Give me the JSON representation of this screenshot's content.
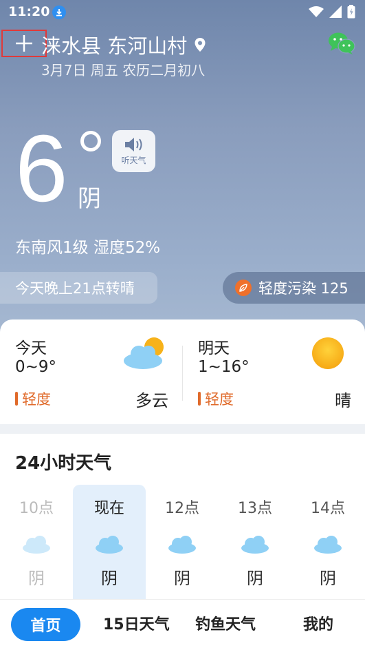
{
  "status_bar": {
    "time": "11:20"
  },
  "header": {
    "location": "涞水县 东河山村",
    "date": "3月7日 周五 农历二月初八"
  },
  "current": {
    "temperature": "6",
    "condition": "阴",
    "listen_label": "听天气",
    "wind_humidity": "东南风1级 湿度52%",
    "tonight": "今天晚上21点转晴",
    "air_quality": "轻度污染 125"
  },
  "forecast": [
    {
      "day": "今天",
      "range": "0~9°",
      "aqi": "轻度",
      "condition": "多云",
      "icon": "partly-cloudy-icon"
    },
    {
      "day": "明天",
      "range": "1~16°",
      "aqi": "轻度",
      "condition": "晴",
      "icon": "sun-icon"
    }
  ],
  "hourly": {
    "title": "24小时天气",
    "items": [
      {
        "time": "10点",
        "condition": "阴",
        "state": "past"
      },
      {
        "time": "现在",
        "condition": "阴",
        "state": "now"
      },
      {
        "time": "12点",
        "condition": "阴",
        "state": "future"
      },
      {
        "time": "13点",
        "condition": "阴",
        "state": "future"
      },
      {
        "time": "14点",
        "condition": "阴",
        "state": "future"
      }
    ]
  },
  "nav": {
    "home": "首页",
    "fifteen_day": "15日天气",
    "fishing": "钓鱼天气",
    "mine": "我的"
  },
  "colors": {
    "accent": "#1a88f0",
    "aqi": "#e06a2a",
    "highlight": "#e03a3a"
  }
}
